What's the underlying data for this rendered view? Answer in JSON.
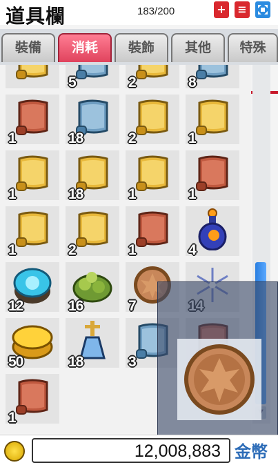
{
  "header": {
    "title": "道具欄",
    "slot_count": "183/200",
    "plus_label": "+",
    "menu_label": "≡"
  },
  "tabs": [
    {
      "label": "裝備",
      "active": false
    },
    {
      "label": "消耗",
      "active": true
    },
    {
      "label": "裝飾",
      "active": false
    },
    {
      "label": "其他",
      "active": false
    },
    {
      "label": "特殊",
      "active": false
    }
  ],
  "items": [
    {
      "name": "yellow-scroll",
      "qty": ""
    },
    {
      "name": "blue-scroll",
      "qty": "5"
    },
    {
      "name": "yellow-scroll",
      "qty": "2"
    },
    {
      "name": "blue-scroll",
      "qty": "8"
    },
    {
      "name": "red-scroll",
      "qty": "1"
    },
    {
      "name": "blue-scroll",
      "qty": "18"
    },
    {
      "name": "yellow-scroll",
      "qty": "2"
    },
    {
      "name": "yellow-scroll",
      "qty": "1"
    },
    {
      "name": "yellow-scroll",
      "qty": "1"
    },
    {
      "name": "yellow-scroll",
      "qty": "18"
    },
    {
      "name": "yellow-scroll",
      "qty": "1"
    },
    {
      "name": "red-scroll",
      "qty": "1"
    },
    {
      "name": "yellow-scroll",
      "qty": "1"
    },
    {
      "name": "yellow-scroll",
      "qty": "2"
    },
    {
      "name": "red-scroll",
      "qty": "1"
    },
    {
      "name": "blue-potion",
      "qty": "4"
    },
    {
      "name": "ice-stone",
      "qty": "12"
    },
    {
      "name": "green-herb-pile",
      "qty": "16"
    },
    {
      "name": "bronze-coin",
      "qty": "7"
    },
    {
      "name": "snowflake",
      "qty": "14"
    },
    {
      "name": "cheese-wheel",
      "qty": "50"
    },
    {
      "name": "holy-water-flask",
      "qty": "18"
    },
    {
      "name": "blue-scroll",
      "qty": "3"
    },
    {
      "name": "red-scroll",
      "qty": ""
    },
    {
      "name": "red-scroll",
      "qty": "1"
    }
  ],
  "tooltip": {
    "item": "bronze-coin"
  },
  "footer": {
    "meso_amount": "12,008,883",
    "meso_label": "金幣"
  },
  "colors": {
    "active_tab": "#e0435d",
    "accent_red": "#c8182a",
    "scroll_blue": "#2a7fe0",
    "meso_label": "#2e6db8"
  }
}
